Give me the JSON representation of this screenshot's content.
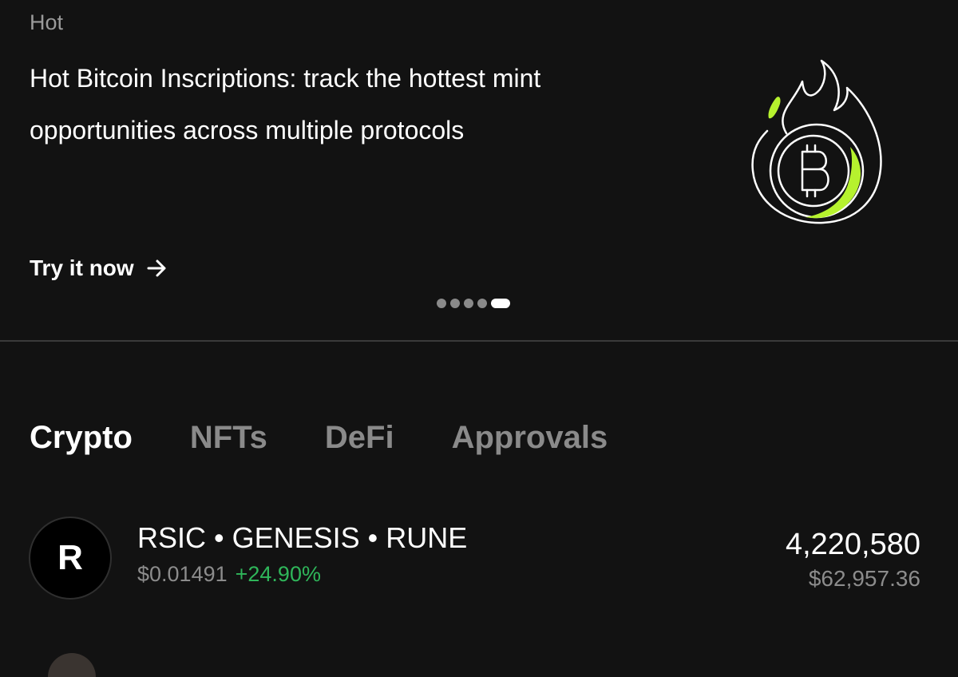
{
  "banner": {
    "tag": "Hot",
    "headline": "Hot Bitcoin Inscriptions: track the hottest mint opportunities across multiple protocols",
    "illustration_icon": "flaming-bitcoin-icon",
    "cta_label": "Try it now",
    "cta_icon": "arrow-right-icon",
    "pager": {
      "total": 5,
      "active_index": 4
    }
  },
  "tabs": [
    {
      "label": "Crypto",
      "active": true
    },
    {
      "label": "NFTs",
      "active": false
    },
    {
      "label": "DeFi",
      "active": false
    },
    {
      "label": "Approvals",
      "active": false
    }
  ],
  "tokens": [
    {
      "avatar_letter": "R",
      "name": "RSIC • GENESIS • RUNE",
      "price": "$0.01491",
      "change": "+24.90%",
      "amount": "4,220,580",
      "value": "$62,957.36"
    }
  ],
  "colors": {
    "background": "#121212",
    "accent": "#b6f22e",
    "positive": "#2fb65a",
    "muted": "#8c8c8c"
  }
}
